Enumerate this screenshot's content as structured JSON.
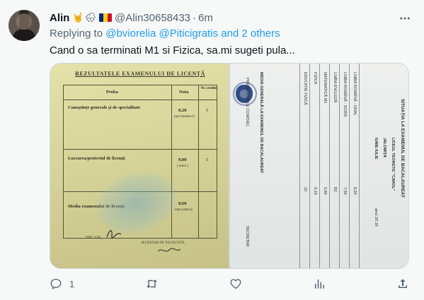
{
  "tweet": {
    "display_name": "Alin",
    "emojis": "🤘🌧",
    "flag_colors": [
      "#002B7F",
      "#FCD116",
      "#CE1126"
    ],
    "handle": "@Alin30658433",
    "separator": "·",
    "time": "6m",
    "reply_prefix": "Replying to",
    "reply_mention_1": "@bviorelia",
    "reply_mention_2": "@Piticigratis and 2 others",
    "text": "Cand o sa terminati M1 si Fizica, sa.mi sugeti pula...",
    "more_icon": "more-horizontal-icon"
  },
  "media": {
    "left_doc": {
      "title": "REZULTATELE EXAMENULUI DE LICENȚĂ",
      "col_proba": "Proba",
      "col_nota": "Nota",
      "col_credits": "Nr. credite",
      "row1_label": "Cunoștințe generale și de specialitate",
      "row1_grade": "8,20",
      "row1_words": "(opt douăzeci)",
      "row1_credits": "5",
      "row2_label": "Lucrarea/proiectul de licență",
      "row2_grade": "9,00",
      "row2_words": "( nouă )",
      "row2_credits": "5",
      "row3_label": "Media examenului de licență",
      "row3_grade": "8,60",
      "row3_words": "(opt șaizeci)",
      "decan": "DECAN,",
      "secretar": "SECRETAR DE FACULTATE,"
    },
    "right_doc": {
      "heading": "SITUAȚIA LA EXAMENUL DE BACALAUREAT",
      "school": "LICEUL TEORETIC \"CAROL\"",
      "city": "JALOMIȚA",
      "session": "IUNIE-IULIE",
      "year": "anul 20 16",
      "subjects": [
        "LIMBA ROMÂNĂ - ORAL",
        "LIMBA ROMÂNĂ - SCRIS",
        "LIMBA ENGLEZĂ",
        "MATEMATICĂ M1",
        "FIZICA",
        "EDUCAȚIE FIZICĂ"
      ],
      "grades": [
        "8,20",
        "7,50",
        "B2",
        "5,80",
        "9,10",
        "10"
      ],
      "media_label": "MEDIA GENERALĂ LA EXAMENUL DE BACALAUREAT",
      "president": "PREȘEDINTELE COMISIEI,",
      "secretary": "SECRETAR"
    }
  },
  "actions": {
    "reply_icon": "reply-icon",
    "reply_count": "1",
    "retweet_icon": "retweet-icon",
    "like_icon": "like-heart-icon",
    "views_icon": "views-chart-icon",
    "share_icon": "share-icon"
  },
  "colors": {
    "text_primary": "#0f1419",
    "text_secondary": "#536471",
    "accent": "#1d9bf0",
    "background": "#f7f9f9"
  }
}
